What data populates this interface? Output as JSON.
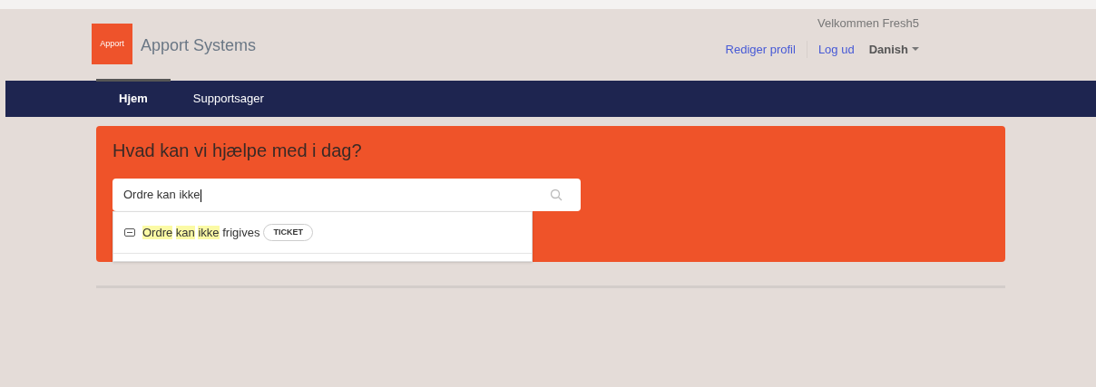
{
  "header": {
    "logo": "Apport",
    "brand": "Apport Systems",
    "welcome": "Velkommen Fresh5",
    "links": [
      "Rediger profil",
      "Log ud"
    ],
    "language": "Danish"
  },
  "nav": [
    {
      "label": "Hjem",
      "selected": true
    },
    {
      "label": "Supportsager",
      "selected": false
    }
  ],
  "hero": {
    "title": "Hvad kan vi hjælpe med i dag?",
    "search_value": "Ordre kan ikke",
    "suggestions": [
      {
        "segments": [
          {
            "text": "Ordre",
            "highlighted": true
          },
          {
            "text": "kan",
            "highlighted": true
          },
          {
            "text": "ikke",
            "highlighted": true
          },
          {
            "text": "frigives",
            "highlighted": false
          }
        ],
        "badge": "TICKET"
      }
    ]
  }
}
